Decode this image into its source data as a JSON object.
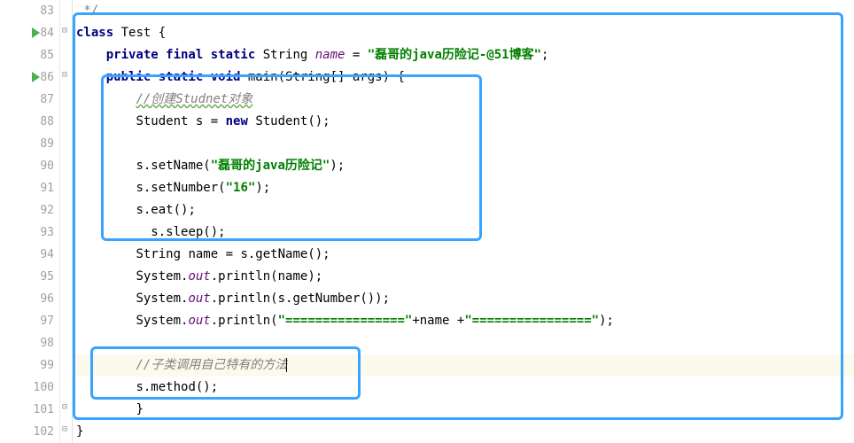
{
  "gutter": {
    "numbers": [
      "83",
      "84",
      "85",
      "86",
      "87",
      "88",
      "89",
      "90",
      "91",
      "92",
      "93",
      "94",
      "95",
      "96",
      "97",
      "98",
      "99",
      "100",
      "101",
      "102"
    ],
    "runMarkers": [
      84,
      86
    ]
  },
  "code": {
    "l83_comment_end": " */",
    "l84_kw_class": "class",
    "l84_classname": " Test {",
    "l85_kw": "private final static",
    "l85_type": " String ",
    "l85_field": "name",
    "l85_eq": " = ",
    "l85_str": "\"磊哥的java历险记-@51博客\"",
    "l85_semi": ";",
    "l86_kw": "public static void",
    "l86_sig": " main(String[] args) {",
    "l87_comment": "//创建Studnet对象",
    "l88_a": "Student s = ",
    "l88_kw": "new",
    "l88_b": " Student();",
    "l90_a": "s.setName(",
    "l90_str": "\"磊哥的java历险记\"",
    "l90_b": ");",
    "l91_a": "s.setNumber(",
    "l91_str": "\"16\"",
    "l91_b": ");",
    "l92": "s.eat();",
    "l93": "  s.sleep();",
    "l94": "String name = s.getName();",
    "l95_a": "System.",
    "l95_out": "out",
    "l95_b": ".println(name);",
    "l96_a": "System.",
    "l96_out": "out",
    "l96_b": ".println(s.getNumber());",
    "l97_a": "System.",
    "l97_out": "out",
    "l97_b": ".println(",
    "l97_str1": "\"================\"",
    "l97_plus1": "+name +",
    "l97_str2": "\"================\"",
    "l97_c": ");",
    "l99_comment": "//子类调用自己特有的方法",
    "l100": "s.method();",
    "l101": "}",
    "l102": "}"
  }
}
